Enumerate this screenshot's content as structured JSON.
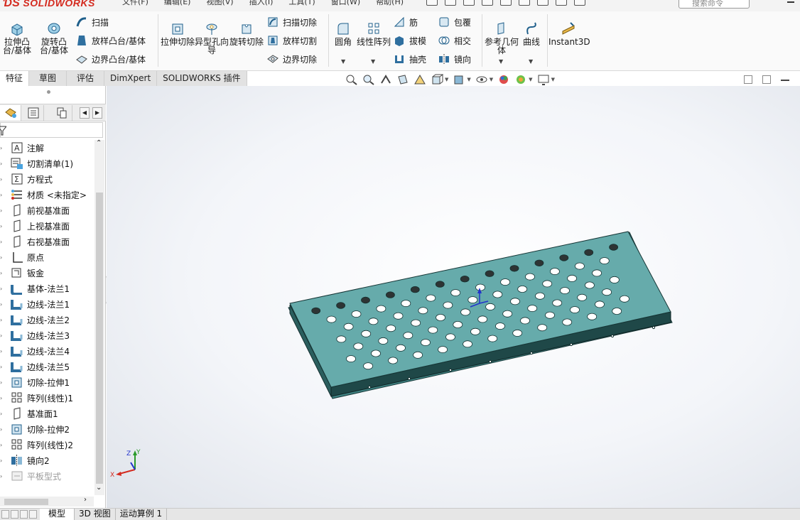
{
  "app": {
    "logo_text": "SOLIDWORKS",
    "menu_items": [
      "文件(F)",
      "编辑(E)",
      "视图(V)",
      "插入(I)",
      "工具(T)",
      "窗口(W)",
      "帮助(H)"
    ],
    "search_placeholder": "搜索命令"
  },
  "ribbon": {
    "extrude_boss": "拉伸凸台/基体",
    "revolve_boss": "旋转凸台/基体",
    "sweep": "扫描",
    "loft_boss": "放样凸台/基体",
    "boundary_boss": "边界凸台/基体",
    "extrude_cut": "拉伸切除",
    "hole_wizard": "异型孔向导",
    "revolve_cut": "旋转切除",
    "sweep_cut": "扫描切除",
    "loft_cut": "放样切割",
    "boundary_cut": "边界切除",
    "fillet": "圆角",
    "linear_pattern": "线性阵列",
    "rib": "筋",
    "draft": "拔模",
    "shell": "抽壳",
    "wrap": "包覆",
    "intersect": "相交",
    "mirror": "镜向",
    "ref_geometry": "参考几何体",
    "curves": "曲线",
    "instant3d": "Instant3D"
  },
  "command_tabs": [
    "特征",
    "草图",
    "评估",
    "DimXpert",
    "SOLIDWORKS 插件"
  ],
  "tree": [
    {
      "label": "注解",
      "icon": "annotation-icon",
      "expandable": true
    },
    {
      "label": "切割清单(1)",
      "icon": "cut-list-icon",
      "expandable": true
    },
    {
      "label": "方程式",
      "icon": "equation-icon",
      "expandable": true
    },
    {
      "label": "材质 <未指定>",
      "icon": "material-icon",
      "expandable": false
    },
    {
      "label": "前视基准面",
      "icon": "plane-icon",
      "expandable": false
    },
    {
      "label": "上视基准面",
      "icon": "plane-icon",
      "expandable": false
    },
    {
      "label": "右视基准面",
      "icon": "plane-icon",
      "expandable": false
    },
    {
      "label": "原点",
      "icon": "origin-icon",
      "expandable": false
    },
    {
      "label": "钣金",
      "icon": "sheet-metal-icon",
      "expandable": true
    },
    {
      "label": "基体-法兰1",
      "icon": "base-flange-icon",
      "expandable": true
    },
    {
      "label": "边线-法兰1",
      "icon": "edge-flange-icon",
      "expandable": true
    },
    {
      "label": "边线-法兰2",
      "icon": "edge-flange-icon",
      "expandable": true
    },
    {
      "label": "边线-法兰3",
      "icon": "edge-flange-icon",
      "expandable": true
    },
    {
      "label": "边线-法兰4",
      "icon": "edge-flange-icon",
      "expandable": true
    },
    {
      "label": "边线-法兰5",
      "icon": "edge-flange-icon",
      "expandable": true
    },
    {
      "label": "切除-拉伸1",
      "icon": "cut-extrude-icon",
      "expandable": true
    },
    {
      "label": "阵列(线性)1",
      "icon": "linear-pattern-icon",
      "expandable": true
    },
    {
      "label": "基准面1",
      "icon": "plane-icon",
      "expandable": false
    },
    {
      "label": "切除-拉伸2",
      "icon": "cut-extrude-icon",
      "expandable": true
    },
    {
      "label": "阵列(线性)2",
      "icon": "linear-pattern-icon",
      "expandable": true
    },
    {
      "label": "镜向2",
      "icon": "mirror-icon",
      "expandable": false
    },
    {
      "label": "平板型式",
      "icon": "flat-pattern-icon",
      "expandable": true,
      "suppressed": true
    }
  ],
  "triad": {
    "x": "X",
    "y": "Y",
    "z": "Z"
  },
  "bottom_tabs": [
    "模型",
    "3D 视图",
    "运动算例 1"
  ],
  "colors": {
    "part": "#5fa3a3",
    "part_top": "#66abab",
    "part_side": "#1f4848",
    "accent": "#d42a1f"
  }
}
